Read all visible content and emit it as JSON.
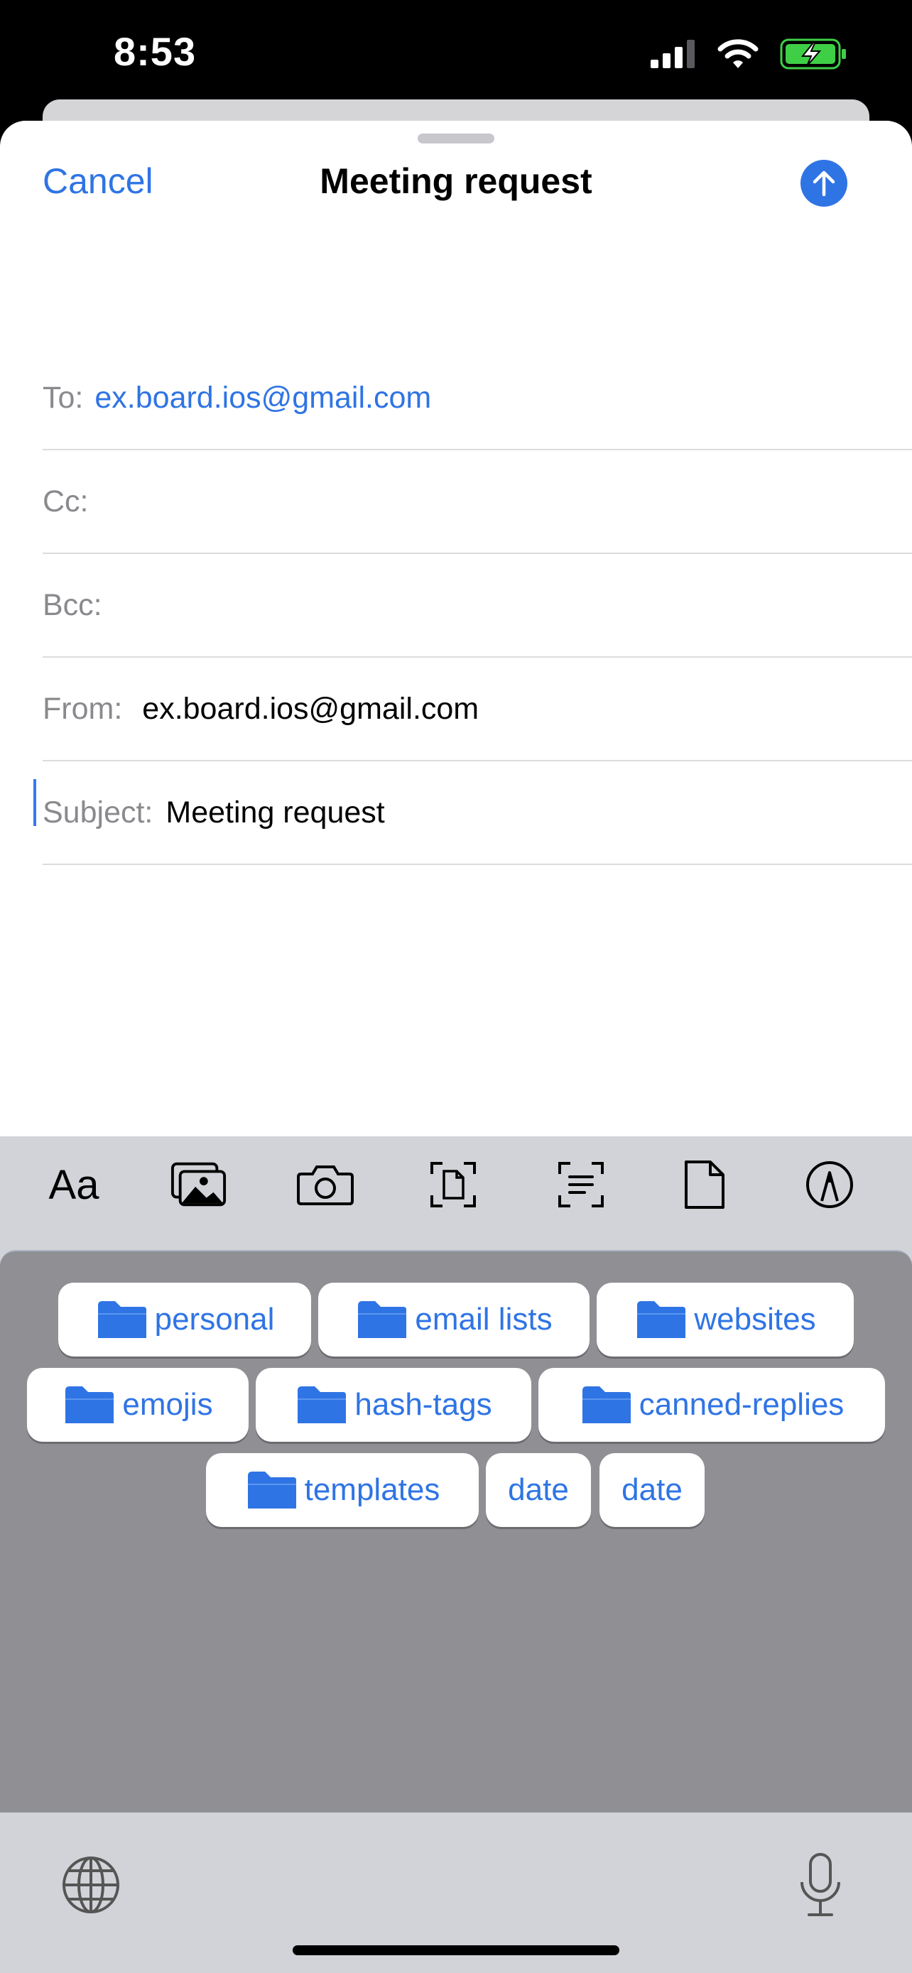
{
  "status_bar": {
    "time": "8:53"
  },
  "compose": {
    "cancel_label": "Cancel",
    "title": "Meeting request",
    "fields": {
      "to_label": "To:",
      "to_value": "ex.board.ios@gmail.com",
      "cc_label": "Cc:",
      "cc_value": "",
      "bcc_label": "Bcc:",
      "bcc_value": "",
      "from_label": "From:",
      "from_value": "ex.board.ios@gmail.com",
      "subject_label": "Subject:",
      "subject_value": "Meeting request"
    },
    "body": ""
  },
  "toolbar": {
    "items": [
      "text-format-icon",
      "photo-library-icon",
      "camera-icon",
      "document-scan-icon",
      "text-scan-icon",
      "file-icon",
      "markup-icon"
    ],
    "text_format_label": "Aa"
  },
  "keyboard_extension": {
    "chips": [
      {
        "label": "personal",
        "folder": true
      },
      {
        "label": "email lists",
        "folder": true
      },
      {
        "label": "websites",
        "folder": true
      },
      {
        "label": "emojis",
        "folder": true
      },
      {
        "label": "hash-tags",
        "folder": true
      },
      {
        "label": "canned-replies",
        "folder": true
      },
      {
        "label": "templates",
        "folder": true
      },
      {
        "label": "date",
        "folder": false
      },
      {
        "label": "date",
        "folder": false
      }
    ]
  },
  "colors": {
    "accent": "#2f74e4",
    "toolbar_bg": "#d2d3d8",
    "panel_bg": "#8f8f94",
    "battery": "#3fcf47"
  }
}
